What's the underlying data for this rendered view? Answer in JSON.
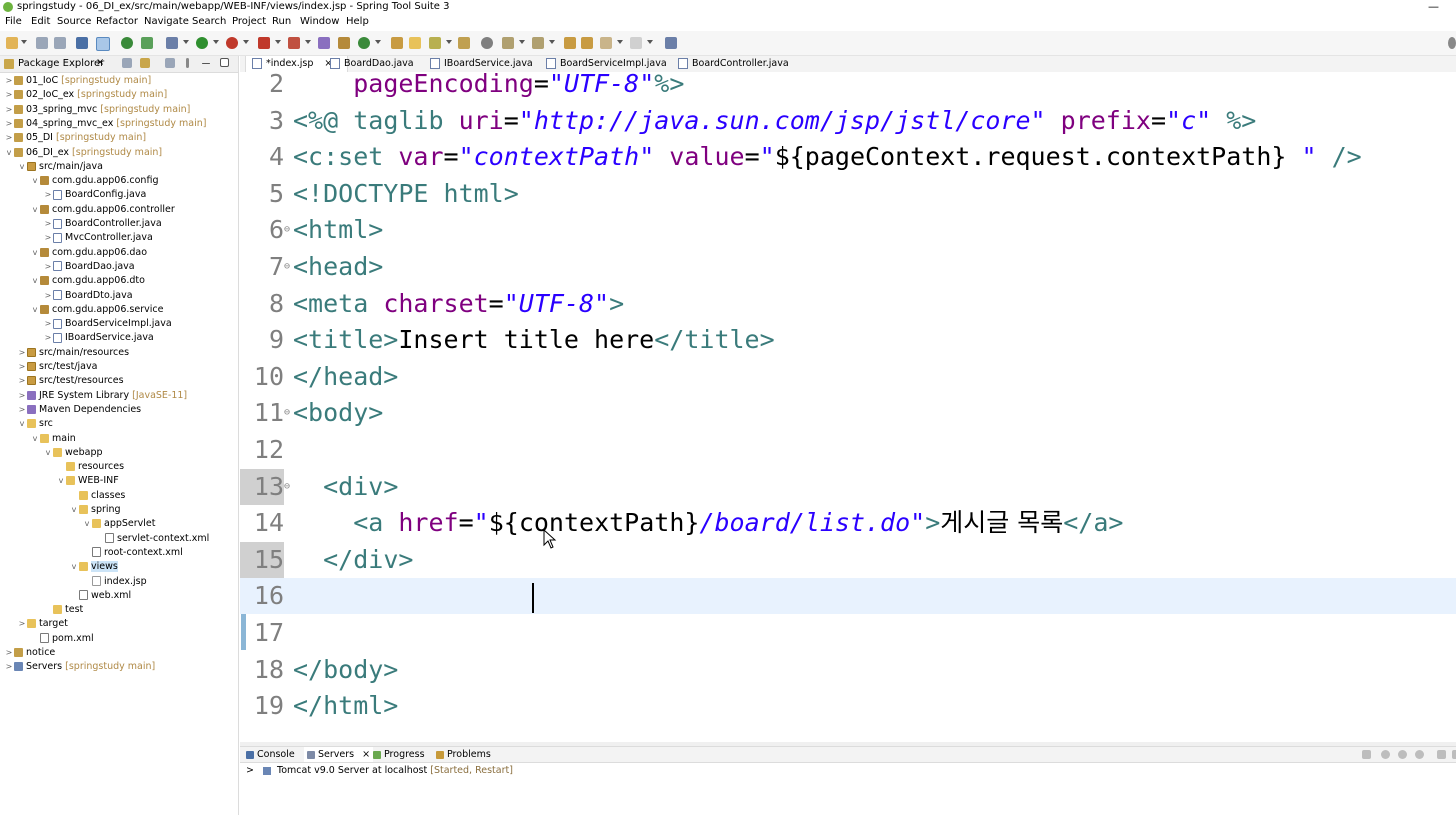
{
  "window": {
    "title": "springstudy - 06_DI_ex/src/main/webapp/WEB-INF/views/index.jsp - Spring Tool Suite 3",
    "minimize": "—"
  },
  "menu": [
    "File",
    "Edit",
    "Source",
    "Refactor",
    "Navigate",
    "Search",
    "Project",
    "Run",
    "Window",
    "Help"
  ],
  "explorer": {
    "title": "Package Explorer",
    "close": "×",
    "rows": [
      {
        "arrow": ">",
        "label": "01_IoC",
        "decoration": " [springstudy main]",
        "icon": "project-icon",
        "kind": "proj"
      },
      {
        "arrow": ">",
        "label": "02_IoC_ex",
        "decoration": " [springstudy main]",
        "icon": "project-icon",
        "kind": "proj"
      },
      {
        "arrow": ">",
        "label": "03_spring_mvc",
        "decoration": " [springstudy main]",
        "icon": "project-icon",
        "kind": "proj"
      },
      {
        "arrow": ">",
        "label": "04_spring_mvc_ex",
        "decoration": " [springstudy main]",
        "icon": "project-icon",
        "kind": "proj"
      },
      {
        "arrow": ">",
        "label": "05_DI",
        "decoration": " [springstudy main]",
        "icon": "project-icon",
        "kind": "proj"
      },
      {
        "arrow": "v",
        "label": "06_DI_ex",
        "decoration": " [springstudy main]",
        "icon": "project-icon",
        "kind": "proj"
      },
      {
        "arrow": "v",
        "label": "src/main/java",
        "decoration": "",
        "icon": "source-folder-icon",
        "kind": "src"
      },
      {
        "arrow": "v",
        "label": "com.gdu.app06.config",
        "decoration": "",
        "icon": "package-icon",
        "kind": "pkg"
      },
      {
        "arrow": ">",
        "label": "BoardConfig.java",
        "decoration": "",
        "icon": "java-file-icon",
        "kind": "java"
      },
      {
        "arrow": "v",
        "label": "com.gdu.app06.controller",
        "decoration": "",
        "icon": "package-icon",
        "kind": "pkg"
      },
      {
        "arrow": ">",
        "label": "BoardController.java",
        "decoration": "",
        "icon": "java-file-icon",
        "kind": "java"
      },
      {
        "arrow": ">",
        "label": "MvcController.java",
        "decoration": "",
        "icon": "java-file-icon",
        "kind": "java"
      },
      {
        "arrow": "v",
        "label": "com.gdu.app06.dao",
        "decoration": "",
        "icon": "package-icon",
        "kind": "pkg"
      },
      {
        "arrow": ">",
        "label": "BoardDao.java",
        "decoration": "",
        "icon": "java-file-icon",
        "kind": "java"
      },
      {
        "arrow": "v",
        "label": "com.gdu.app06.dto",
        "decoration": "",
        "icon": "package-icon",
        "kind": "pkg"
      },
      {
        "arrow": ">",
        "label": "BoardDto.java",
        "decoration": "",
        "icon": "java-file-icon",
        "kind": "java"
      },
      {
        "arrow": "v",
        "label": "com.gdu.app06.service",
        "decoration": "",
        "icon": "package-icon",
        "kind": "pkg"
      },
      {
        "arrow": ">",
        "label": "BoardServiceImpl.java",
        "decoration": "",
        "icon": "java-file-icon",
        "kind": "java"
      },
      {
        "arrow": ">",
        "label": "IBoardService.java",
        "decoration": "",
        "icon": "java-file-icon",
        "kind": "java"
      },
      {
        "arrow": ">",
        "label": "src/main/resources",
        "decoration": "",
        "icon": "source-folder-icon",
        "kind": "src"
      },
      {
        "arrow": ">",
        "label": "src/test/java",
        "decoration": "",
        "icon": "source-folder-icon",
        "kind": "src"
      },
      {
        "arrow": ">",
        "label": "src/test/resources",
        "decoration": "",
        "icon": "source-folder-icon",
        "kind": "src"
      },
      {
        "arrow": ">",
        "label": "JRE System Library",
        "decoration": " [JavaSE-11]",
        "icon": "library-icon",
        "kind": "lib"
      },
      {
        "arrow": ">",
        "label": "Maven Dependencies",
        "decoration": "",
        "icon": "library-icon",
        "kind": "lib"
      },
      {
        "arrow": "v",
        "label": "src",
        "decoration": "",
        "icon": "folder-icon",
        "kind": "folder"
      },
      {
        "arrow": "v",
        "label": "main",
        "decoration": "",
        "icon": "folder-icon",
        "kind": "folder"
      },
      {
        "arrow": "v",
        "label": "webapp",
        "decoration": "",
        "icon": "folder-icon",
        "kind": "folder"
      },
      {
        "arrow": "",
        "label": "resources",
        "decoration": "",
        "icon": "folder-icon",
        "kind": "folder"
      },
      {
        "arrow": "v",
        "label": "WEB-INF",
        "decoration": "",
        "icon": "folder-icon",
        "kind": "folder"
      },
      {
        "arrow": "",
        "label": "classes",
        "decoration": "",
        "icon": "folder-icon",
        "kind": "folder"
      },
      {
        "arrow": "v",
        "label": "spring",
        "decoration": "",
        "icon": "folder-icon",
        "kind": "folder"
      },
      {
        "arrow": "v",
        "label": "appServlet",
        "decoration": "",
        "icon": "folder-icon",
        "kind": "folder"
      },
      {
        "arrow": "",
        "label": "servlet-context.xml",
        "decoration": "",
        "icon": "xml-file-icon",
        "kind": "xml"
      },
      {
        "arrow": "",
        "label": "root-context.xml",
        "decoration": "",
        "icon": "xml-file-icon",
        "kind": "xml"
      },
      {
        "arrow": "v",
        "label": "views",
        "decoration": "",
        "icon": "folder-icon",
        "kind": "folder",
        "selected": true
      },
      {
        "arrow": "",
        "label": "index.jsp",
        "decoration": "",
        "icon": "jsp-file-icon",
        "kind": "jsp"
      },
      {
        "arrow": "",
        "label": "web.xml",
        "decoration": "",
        "icon": "xml-file-icon",
        "kind": "xml"
      },
      {
        "arrow": "",
        "label": "test",
        "decoration": "",
        "icon": "folder-icon",
        "kind": "folder"
      },
      {
        "arrow": ">",
        "label": "target",
        "decoration": "",
        "icon": "folder-icon",
        "kind": "folder"
      },
      {
        "arrow": "",
        "label": "pom.xml",
        "decoration": "",
        "icon": "xml-file-icon",
        "kind": "xml"
      },
      {
        "arrow": ">",
        "label": "notice",
        "decoration": "",
        "icon": "project-icon",
        "kind": "proj"
      },
      {
        "arrow": ">",
        "label": "Servers",
        "decoration": " [springstudy main]",
        "icon": "server-icon",
        "kind": "server"
      }
    ]
  },
  "editor_tabs": [
    {
      "label": "*index.jsp",
      "active": true,
      "close": "×"
    },
    {
      "label": "BoardDao.java",
      "active": false
    },
    {
      "label": "IBoardService.java",
      "active": false
    },
    {
      "label": "BoardServiceImpl.java",
      "active": false
    },
    {
      "label": "BoardController.java",
      "active": false
    }
  ],
  "code_lines": [
    {
      "num": "2",
      "fold": "",
      "tokens": [
        {
          "t": "    ",
          "c": "plain"
        },
        {
          "t": "pageEncoding",
          "c": "at"
        },
        {
          "t": "=",
          "c": "plain"
        },
        {
          "t": "\"UTF-8\"",
          "c": "val"
        },
        {
          "t": "%>",
          "c": "tg"
        }
      ]
    },
    {
      "num": "3",
      "fold": "",
      "tokens": [
        {
          "t": "<%@ ",
          "c": "tg"
        },
        {
          "t": "taglib ",
          "c": "el"
        },
        {
          "t": "uri",
          "c": "at"
        },
        {
          "t": "=",
          "c": "plain"
        },
        {
          "t": "\"http://java.sun.com/jsp/jstl/core\"",
          "c": "val"
        },
        {
          "t": " prefix",
          "c": "at"
        },
        {
          "t": "=",
          "c": "plain"
        },
        {
          "t": "\"c\"",
          "c": "val"
        },
        {
          "t": " %>",
          "c": "tg"
        }
      ]
    },
    {
      "num": "4",
      "fold": "",
      "tokens": [
        {
          "t": "<c:set ",
          "c": "el"
        },
        {
          "t": "var",
          "c": "at"
        },
        {
          "t": "=",
          "c": "plain"
        },
        {
          "t": "\"contextPath\"",
          "c": "val"
        },
        {
          "t": " value",
          "c": "at"
        },
        {
          "t": "=",
          "c": "plain"
        },
        {
          "t": "\"",
          "c": "val"
        },
        {
          "t": "${pageContext.request.contextPath}",
          "c": "plain"
        },
        {
          "t": " \"",
          "c": "val"
        },
        {
          "t": " />",
          "c": "el"
        }
      ]
    },
    {
      "num": "5",
      "fold": "",
      "tokens": [
        {
          "t": "<!DOCTYPE html>",
          "c": "el"
        }
      ]
    },
    {
      "num": "6",
      "fold": "⊖",
      "tokens": [
        {
          "t": "<html>",
          "c": "el"
        }
      ]
    },
    {
      "num": "7",
      "fold": "⊖",
      "tokens": [
        {
          "t": "<head>",
          "c": "el"
        }
      ]
    },
    {
      "num": "8",
      "fold": "",
      "tokens": [
        {
          "t": "<meta ",
          "c": "el"
        },
        {
          "t": "charset",
          "c": "at"
        },
        {
          "t": "=",
          "c": "plain"
        },
        {
          "t": "\"UTF-8\"",
          "c": "val"
        },
        {
          "t": ">",
          "c": "el"
        }
      ]
    },
    {
      "num": "9",
      "fold": "",
      "tokens": [
        {
          "t": "<title>",
          "c": "el"
        },
        {
          "t": "Insert title here",
          "c": "plain"
        },
        {
          "t": "</title>",
          "c": "el"
        }
      ]
    },
    {
      "num": "10",
      "fold": "",
      "tokens": [
        {
          "t": "</head>",
          "c": "el"
        }
      ]
    },
    {
      "num": "11",
      "fold": "⊖",
      "tokens": [
        {
          "t": "<body>",
          "c": "el"
        }
      ]
    },
    {
      "num": "12",
      "fold": "",
      "tokens": []
    },
    {
      "num": "13",
      "fold": "⊖",
      "tokens": [
        {
          "t": "  ",
          "c": "plain"
        },
        {
          "t": "<div>",
          "c": "el"
        }
      ],
      "numbg": true
    },
    {
      "num": "14",
      "fold": "",
      "tokens": [
        {
          "t": "    ",
          "c": "plain"
        },
        {
          "t": "<a ",
          "c": "el"
        },
        {
          "t": "href",
          "c": "at"
        },
        {
          "t": "=",
          "c": "plain"
        },
        {
          "t": "\"",
          "c": "val"
        },
        {
          "t": "${contextPath}",
          "c": "plain"
        },
        {
          "t": "/board/list.do\"",
          "c": "val"
        },
        {
          "t": ">",
          "c": "el"
        },
        {
          "t": "게시글 목록",
          "c": "plain ko"
        },
        {
          "t": "</a>",
          "c": "el"
        }
      ]
    },
    {
      "num": "15",
      "fold": "",
      "tokens": [
        {
          "t": "  ",
          "c": "plain"
        },
        {
          "t": "</div>",
          "c": "el"
        }
      ],
      "numbg": true
    },
    {
      "num": "16",
      "fold": "",
      "tokens": [],
      "current": true
    },
    {
      "num": "17",
      "fold": "",
      "tokens": []
    },
    {
      "num": "18",
      "fold": "",
      "tokens": [
        {
          "t": "</body>",
          "c": "el"
        }
      ]
    },
    {
      "num": "19",
      "fold": "",
      "tokens": [
        {
          "t": "</html>",
          "c": "el"
        }
      ]
    }
  ],
  "bottom_tabs": [
    {
      "label": "Console",
      "icon": "console-icon",
      "color": "#4a6fa5"
    },
    {
      "label": "Servers",
      "icon": "servers-icon",
      "color": "#7d8aa6",
      "close": "×",
      "active": true
    },
    {
      "label": "Progress",
      "icon": "progress-icon",
      "color": "#6aa84f"
    },
    {
      "label": "Problems",
      "icon": "problems-icon",
      "color": "#c79a3a"
    }
  ],
  "server_row": {
    "arrow": ">",
    "label": "Tomcat v9.0 Server at localhost",
    "status": "  [Started, Restart]"
  },
  "colors": {
    "tag": "#3a7b7b",
    "attribute": "#7f007f",
    "string": "#2a00ff",
    "current_line": "#e8f2fe"
  }
}
